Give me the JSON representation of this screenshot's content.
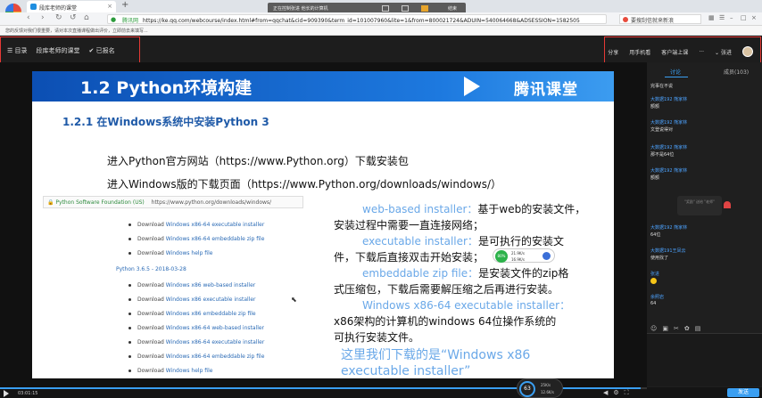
{
  "browser": {
    "tab_title": "段库老师的课堂",
    "url_secure": "腾讯网",
    "url_text": "https://ke.qq.com/webcourse/index.html#from=qqchat&cid=909390&term_id=101007960&lite=1&from=800021724&ADUIN=540064668&ADSESSION=1582505",
    "search_box": "要搜刮信就来新浪",
    "bookmarks": "您的反馈对我们很重要，请对本次直播课程做出评价，立即前去来填写..."
  },
  "overlay": {
    "text": "正在控制张进  他长的计算机",
    "end_label": "结束"
  },
  "course": {
    "menu_label": "目录",
    "class_name": "段库老师的课堂",
    "enrolled_label": "已报名",
    "right_items": [
      "分享",
      "用手机看",
      "客户端上课",
      "···"
    ],
    "user_name": "张进"
  },
  "slide": {
    "title": "1.2 Python环境构建",
    "brand": "腾讯课堂",
    "subtitle": "1.2.1 在Windows系统中安装Python 3",
    "line1": "进入Python官方网站（https://www.Python.org）下载安装包",
    "line2": "进入Windows版的下载页面（https://www.Python.org/downloads/windows/）",
    "shot_site": "Python Software Foundation (US)",
    "shot_url": "https://www.python.org/downloads/windows/",
    "shot_rows_top": [
      {
        "prefix": "Download ",
        "link": "Windows x86-64 executable installer"
      },
      {
        "prefix": "Download ",
        "link": "Windows x86-64 embeddable zip file"
      },
      {
        "prefix": "Download ",
        "link": "Windows help file"
      }
    ],
    "shot_version": "Python 3.6.5 - 2018-03-28",
    "shot_rows_bottom": [
      {
        "prefix": "Download ",
        "link": "Windows x86 web-based installer"
      },
      {
        "prefix": "Download ",
        "link": "Windows x86 executable installer"
      },
      {
        "prefix": "Download ",
        "link": "Windows x86 embeddable zip file"
      },
      {
        "prefix": "Download ",
        "link": "Windows x86-64 web-based installer"
      },
      {
        "prefix": "Download ",
        "link": "Windows x86-64 executable installer"
      },
      {
        "prefix": "Download ",
        "link": "Windows x86-64 embeddable zip file"
      },
      {
        "prefix": "Download ",
        "link": "Windows help file"
      }
    ],
    "desc1_blue": "web-based installer：",
    "desc1_black": "基于web的安装文件，",
    "desc2": "安装过程中需要一直连接网络；",
    "desc3_blue": "executable installer：",
    "desc3_black": "是可执行的安装文",
    "desc4": "件，下载后直接双击开始安装；",
    "desc5_blue": "embeddable zip file：",
    "desc5_black": "是安装文件的zip格",
    "desc6": "式压缩包，下载后需要解压缩之后再进行安装。",
    "desc7_blue": "Windows x86-64 executable installer：",
    "desc8": "x86架构的计算机的windows 64位操作系统的",
    "desc9": "可执行安装文件。",
    "highlight1": "这里我们下载的是“Windows x86",
    "highlight2": "executable installer”",
    "speed_pct": "80%",
    "speed_up": "21.9K/s",
    "speed_down": "16.9K/s"
  },
  "chat": {
    "tab_chat": "讨论",
    "tab_members": "成员(103)",
    "messages": [
      {
        "user": "",
        "text": "完事在不说"
      },
      {
        "user": "大数据192 熊家林",
        "text": "额额"
      },
      {
        "user": "大数据192 熊家林",
        "text": "文登说得对"
      },
      {
        "user": "大数据192 熊家林",
        "text": "那不是64位"
      },
      {
        "user": "大数据192 熊家林",
        "text": "额额"
      },
      {
        "user": "大数据192 熊家林",
        "text": "64位"
      },
      {
        "user": "大数据191王凤云",
        "text": "使用找了"
      },
      {
        "user": "张进",
        "text": ""
      },
      {
        "user": "余照岩",
        "text": "64"
      }
    ],
    "gift_text": "\"奖励\" 送给 \"老师\"",
    "send_label": "发送"
  },
  "player": {
    "time": "03:01:15",
    "progress": 0.99,
    "rec_value": "63",
    "rec_up": "25K/s",
    "rec_down": "12.6K/s"
  },
  "colors": {
    "accent": "#3a9ff2",
    "slide_blue": "#1d79df",
    "highlight_red": "#e53935"
  }
}
